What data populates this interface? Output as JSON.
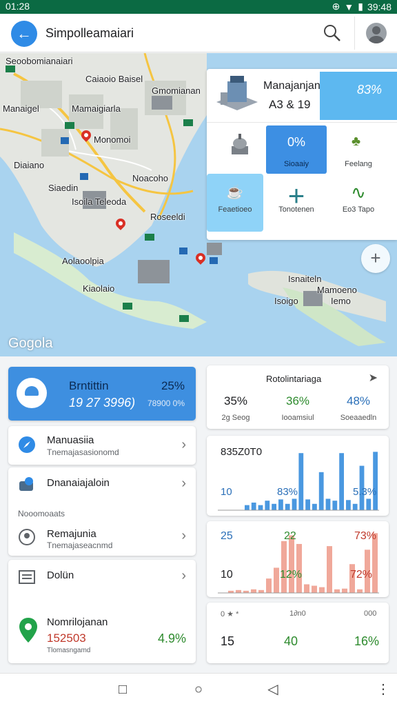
{
  "status": {
    "time": "01:28",
    "right_time": "39:48"
  },
  "app_bar": {
    "title": "Simpolleamaiari"
  },
  "map": {
    "labels": [
      "Seoobomianaiari",
      "Caiaoio Baisel",
      "Gmomianan",
      "Mamaigiarla",
      "Manaigel",
      "Monomoi",
      "Diaiano",
      "Noacoho",
      "Siaedin",
      "Isoila Teleoda",
      "Roseeldi",
      "Aolaoolpia",
      "Isnaiteln",
      "Kiaolaio",
      "Isoigo",
      "Mamoeno",
      "Iemo"
    ],
    "logo": "Gogola"
  },
  "panel": {
    "title": "Manajanjan",
    "code": "A3 & 19",
    "pct": "83%",
    "tiles": [
      {
        "label": "",
        "icon": "capitol-icon"
      },
      {
        "label": "Sioaaiy",
        "value": "0%",
        "icon": "info-icon"
      },
      {
        "label": "Feelang",
        "icon": "park-icon"
      },
      {
        "label": "Feaetioeo",
        "icon": "food-icon"
      },
      {
        "label": "Tonotenen",
        "icon": "plus-icon"
      },
      {
        "label": "Eo3 Tapo",
        "icon": "chart-icon"
      }
    ]
  },
  "primary_card": {
    "title": "Brntittin",
    "value": "19 27 3996)",
    "pct": "25%",
    "sub": "78900 0%"
  },
  "list": [
    {
      "title": "Manuasiia",
      "sub": "Tnemajasasionomd"
    },
    {
      "title": "Dnanaiajaloin",
      "sub": ""
    },
    {
      "section": "Nooomoaats"
    },
    {
      "title": "Remajunia",
      "sub": "Tnemajaseacnmd"
    },
    {
      "title": "Dolün",
      "sub": ""
    },
    {
      "title": "Nomrilojanan",
      "value": "152503",
      "sub": "Tlomasngamd",
      "pct": "4.9%"
    }
  ],
  "stats": {
    "header": "Rotolintariaga",
    "cols": [
      {
        "value": "35%",
        "sub": "2g Seog",
        "color": "#202124"
      },
      {
        "value": "36%",
        "sub": "Iooamsiul",
        "color": "#2e8b2e"
      },
      {
        "value": "48%",
        "sub": "Soeaaedln",
        "color": "#2a6fb8"
      }
    ]
  },
  "chart_data": [
    {
      "type": "bar",
      "title": "835Z0T0",
      "ylabel": "",
      "labels": [
        "10",
        "83%",
        "5.3%"
      ],
      "colors": {
        "bar": "#4a98e0",
        "label": "#2a6fb8"
      },
      "values": [
        0.8,
        1.2,
        0.8,
        1.5,
        1.0,
        1.7,
        1.0,
        1.8,
        9.0,
        1.7,
        1.0,
        6.0,
        1.8,
        1.5,
        9.0,
        1.6,
        1.0,
        7.0,
        1.8,
        9.2
      ]
    },
    {
      "type": "bar",
      "title": "",
      "labels": [
        "25",
        "22",
        "73%",
        "10",
        "12%",
        "72%"
      ],
      "colors": {
        "bar": "#f0a89a",
        "label_left": "#2a6fb8",
        "label_mid": "#2e8b2e",
        "label_right": "#c0392b"
      },
      "values": [
        0.3,
        0.4,
        0.3,
        0.5,
        0.4,
        2.0,
        3.5,
        7.2,
        8.0,
        6.8,
        1.2,
        1.0,
        0.8,
        6.5,
        0.5,
        0.6,
        4.0,
        0.5,
        6.0,
        8.3
      ]
    }
  ],
  "summary_card": {
    "top": [
      "0 ★ *",
      "1∂n0",
      "000"
    ],
    "values": [
      "15",
      "40",
      "16%"
    ],
    "value_colors": [
      "#202124",
      "#2e8b2e",
      "#2e8b2e"
    ],
    "pct_suffix": "%"
  }
}
